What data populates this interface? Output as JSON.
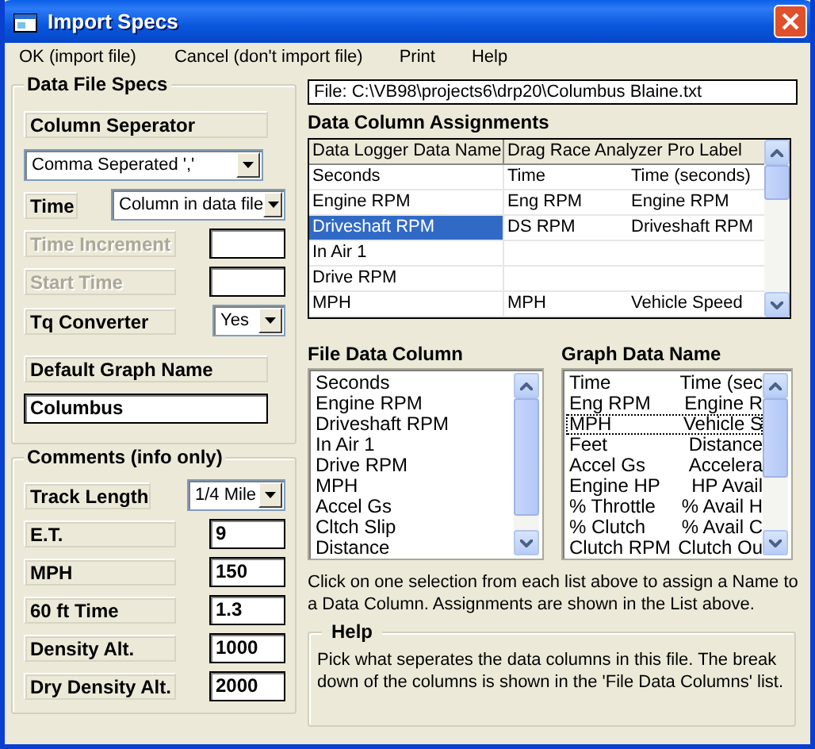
{
  "window": {
    "title": "Import Specs"
  },
  "menu": [
    "OK (import file)",
    "Cancel (don't import file)",
    "Print",
    "Help"
  ],
  "data_file_specs": {
    "title": "Data File Specs",
    "column_separator": {
      "label": "Column Seperator",
      "value": "Comma Seperated ','"
    },
    "rows": [
      {
        "kind": "select",
        "label": "Time",
        "value": "Column in data file",
        "disabled": false
      },
      {
        "kind": "input",
        "label": "Time Increment",
        "disabled": true
      },
      {
        "kind": "input",
        "label": "Start Time",
        "disabled": true
      },
      {
        "kind": "select",
        "label": "Tq Converter",
        "value": "Yes",
        "disabled": false
      }
    ],
    "default_graph_name": {
      "label": "Default Graph Name",
      "value": "Columbus"
    }
  },
  "comments": {
    "title": "Comments (info only)",
    "track_length": {
      "label": "Track Length",
      "value": "1/4 Mile"
    },
    "fields": [
      {
        "label": "E.T.",
        "value": "9"
      },
      {
        "label": "MPH",
        "value": "150"
      },
      {
        "label": "60 ft Time",
        "value": "1.3"
      },
      {
        "label": "Density Alt.",
        "value": "1000"
      },
      {
        "label": "Dry Density Alt.",
        "value": "2000"
      }
    ]
  },
  "file_path": "File: C:\\VB98\\projects6\\drp20\\Columbus Blaine.txt",
  "assignments": {
    "title": "Data Column Assignments",
    "columns": [
      "Data Logger Data Name",
      "Drag Race Analyzer Pro Label"
    ],
    "rows": [
      {
        "cells": [
          "Seconds",
          "Time",
          "Time (seconds)"
        ],
        "selected": false
      },
      {
        "cells": [
          "Engine RPM",
          "Eng RPM",
          "Engine RPM"
        ],
        "selected": false
      },
      {
        "cells": [
          "Driveshaft RPM",
          "DS RPM",
          "Driveshaft RPM"
        ],
        "selected": true
      },
      {
        "cells": [
          "In Air 1"
        ],
        "selected": false
      },
      {
        "cells": [
          "Drive RPM"
        ],
        "selected": false
      },
      {
        "cells": [
          "MPH",
          "MPH",
          "Vehicle Speed"
        ],
        "selected": false
      }
    ]
  },
  "file_data_column": {
    "title": "File Data Column",
    "items": [
      {
        "label": "Seconds",
        "selected": false
      },
      {
        "label": "Engine RPM",
        "selected": false
      },
      {
        "label": "Driveshaft RPM",
        "selected": false
      },
      {
        "label": "In Air 1",
        "selected": false
      },
      {
        "label": "Drive RPM",
        "selected": false
      },
      {
        "label": "MPH",
        "selected": false
      },
      {
        "label": "Accel Gs",
        "selected": false
      },
      {
        "label": "Cltch Slip",
        "selected": false
      },
      {
        "label": "Distance",
        "selected": false
      }
    ]
  },
  "graph_data_name": {
    "title": "Graph Data Name",
    "items": [
      {
        "name": "Time",
        "label": "Time (sec",
        "selected": false
      },
      {
        "name": "Eng RPM",
        "label": "Engine R",
        "selected": false
      },
      {
        "name": "MPH",
        "label": "Vehicle S",
        "selected": true
      },
      {
        "name": "Feet",
        "label": "Distance",
        "selected": false
      },
      {
        "name": "Accel Gs",
        "label": "Accelera",
        "selected": false
      },
      {
        "name": "Engine HP",
        "label": "HP Avail",
        "selected": false
      },
      {
        "name": "% Throttle",
        "label": "% Avail H",
        "selected": false
      },
      {
        "name": "% Clutch",
        "label": "% Avail C",
        "selected": false
      },
      {
        "name": "Clutch RPM",
        "label": "Clutch Ou",
        "selected": false
      }
    ]
  },
  "instructions": "Click on one selection from each list above to assign a Name to a Data Column.  Assignments are shown in the List above.",
  "help": {
    "title": "Help",
    "text": "Pick what seperates the data columns in this file.  The break down of the columns is shown in the 'File Data Columns' list."
  }
}
